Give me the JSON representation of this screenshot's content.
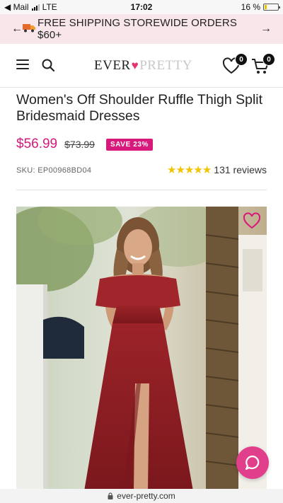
{
  "status_bar": {
    "carrier": "◀ Mail",
    "network": "LTE",
    "time": "17:02",
    "battery": "16 %",
    "battery_level": 0.16
  },
  "promo": {
    "text": "FREE SHIPPING STOREWIDE ORDERS $60+",
    "left_icon": "arrow-left-icon",
    "right_icon": "arrow-right-icon",
    "truck_icon": "truck-icon"
  },
  "header": {
    "logo_part1": "EVER",
    "logo_heart": "♥",
    "logo_part2": "PRETTY",
    "wishlist_count": "0",
    "cart_count": "0"
  },
  "product": {
    "title": "Women's Off Shoulder Ruffle Thigh Split Bridesmaid Dresses",
    "price": "$56.99",
    "compare_price": "$73.99",
    "save_label": "SAVE 23%",
    "sku": "SKU: EP00968BD04",
    "rating_stars": 5,
    "reviews": "131 reviews"
  },
  "browser": {
    "url": "ever-pretty.com"
  },
  "colors": {
    "accent": "#d6197b",
    "promo_bg": "#f8e6ea",
    "dress": "#8e1f24",
    "star": "#f3c300",
    "chat": "#e13f8b"
  }
}
